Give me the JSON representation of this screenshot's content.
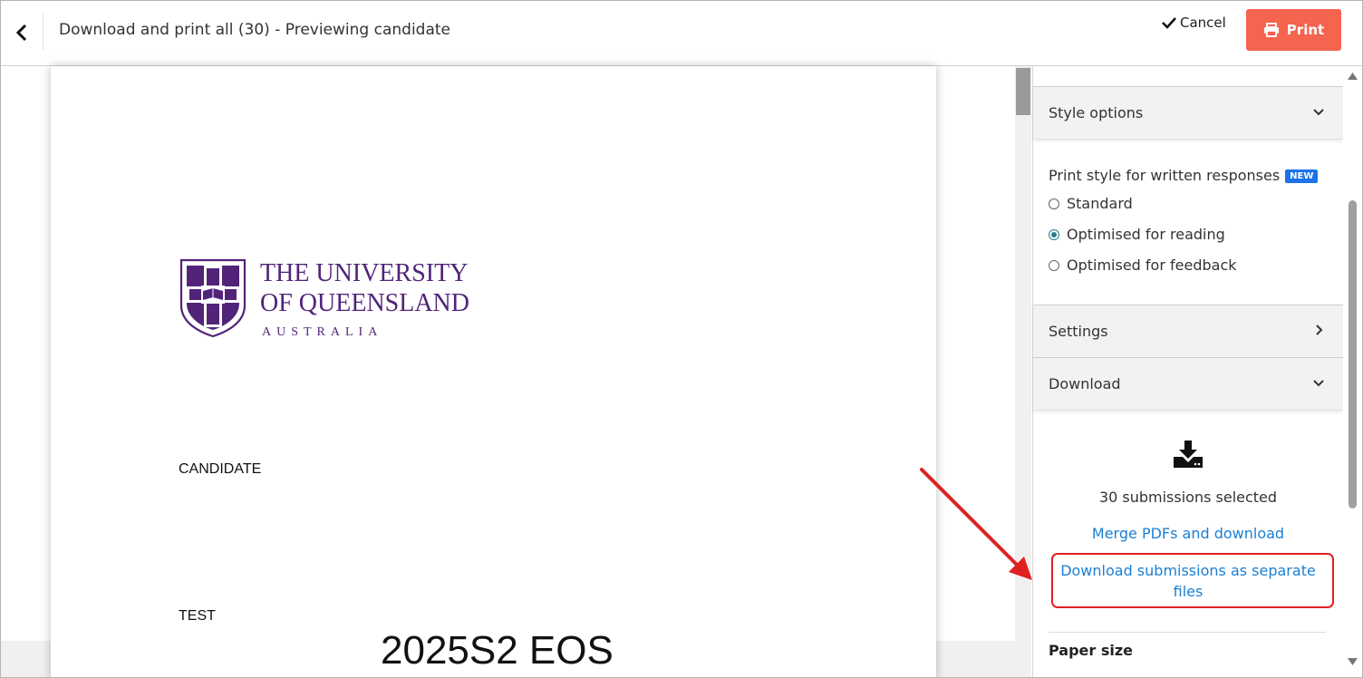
{
  "header": {
    "title": "Download and print all (30) - Previewing candidate",
    "cancel_label": "Cancel",
    "print_label": "Print"
  },
  "preview": {
    "logo_lines": [
      "THE UNIVERSITY",
      "OF QUEENSLAND",
      "AUSTRALIA"
    ],
    "candidate_label": "CANDIDATE",
    "test_label": "TEST",
    "exam_title": "2025S2 EOS"
  },
  "panel": {
    "style_options": "Style options",
    "print_style_label": "Print style for written responses",
    "new_badge": "NEW",
    "radios": [
      {
        "label": "Standard",
        "selected": false
      },
      {
        "label": "Optimised for reading",
        "selected": true
      },
      {
        "label": "Optimised for feedback",
        "selected": false
      }
    ],
    "settings": "Settings",
    "download": "Download",
    "selected_count": "30 submissions selected",
    "merge_link": "Merge PDFs and download",
    "separate_link": "Download submissions as separate files",
    "paper_size": "Paper size"
  },
  "colors": {
    "print_button": "#f4644f",
    "link": "#1a7fd4",
    "highlight": "#e02020",
    "radio_selected": "#2a7a8c",
    "uq_purple": "#51247a"
  },
  "icons": [
    "chevron-left-icon",
    "check-icon",
    "printer-icon",
    "chevron-down-icon",
    "chevron-right-icon",
    "download-icon"
  ]
}
